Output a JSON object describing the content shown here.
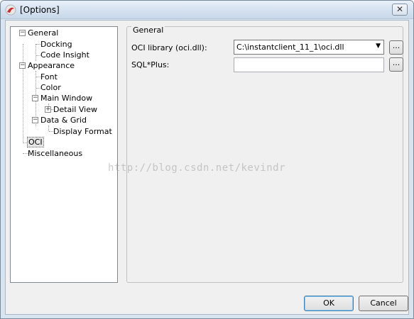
{
  "window": {
    "title": "[Options]",
    "close_glyph": "✕",
    "colors": {
      "title_bar": "#d3e0ef",
      "client": "#f0f0f0",
      "selection": "#e6e6e6"
    }
  },
  "tree": {
    "general": "General",
    "docking": "Docking",
    "code_insight": "Code Insight",
    "appearance": "Appearance",
    "font": "Font",
    "color": "Color",
    "main_window": "Main Window",
    "detail_view": "Detail View",
    "data_grid": "Data & Grid",
    "display_format": "Display Format",
    "oci": "OCI",
    "miscellaneous": "Miscellaneous",
    "collapse_glyph": "−",
    "expand_glyph": "+"
  },
  "panel": {
    "group_title": "General",
    "oci_label": "OCI library (oci.dll):",
    "oci_value": "C:\\instantclient_11_1\\oci.dll",
    "sqlplus_label": "SQL*Plus:",
    "sqlplus_value": "",
    "browse_label": "...",
    "dropdown_glyph": "▼"
  },
  "buttons": {
    "ok": "OK",
    "cancel": "Cancel"
  },
  "watermark": "http://blog.csdn.net/kevindr",
  "icons": {
    "app": "app-logo-icon",
    "close": "close-icon",
    "expander": "tree-expander-icon",
    "dropdown": "chevron-down-icon"
  }
}
